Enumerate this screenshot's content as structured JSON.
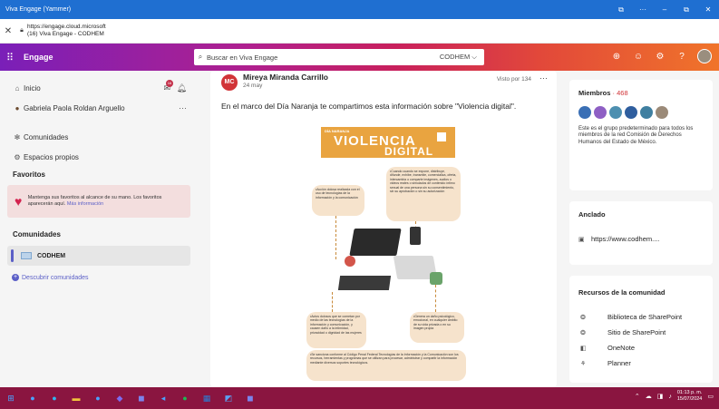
{
  "window": {
    "title": "Viva Engage (Yammer)",
    "controls": {
      "extension": "⧉",
      "more": "···",
      "minimize": "–",
      "restore": "⧉",
      "close": "✕"
    }
  },
  "address": {
    "url_line1": "https://engage.cloud.microsoft",
    "url_line2": "(16) Viva Engage - CODHEM"
  },
  "header": {
    "brand": "Engage",
    "search_placeholder": "Buscar en Viva Engage",
    "search_scope": "CODHEM ⌵"
  },
  "sidebar": {
    "inicio": "Inicio",
    "inicio_badge": "16",
    "user_name": "Gabriela Paola Roldan Arguello",
    "user_more": "···",
    "comunidades": "Comunidades",
    "espacios": "Espacios propios",
    "favoritos_title": "Favoritos",
    "favoritos_text": "Mantenga sus favoritos al alcance de su mano. Los favoritos aparecerán aquí.",
    "favoritos_link": "Más información",
    "comunidades_title": "Comunidades",
    "community_name": "CODHEM",
    "discover": "Descubrir comunidades"
  },
  "post": {
    "avatar_initials": "MC",
    "author": "Mireya Miranda Carrillo",
    "date": "24 may",
    "seen_by": "Visto por 134",
    "more": "···",
    "text": "En el marco del Día Naranja te compartimos esta información sobre \"Violencia digital\".",
    "infographic": {
      "kicker": "DÍA NARANJA",
      "title1": "VIOLENCIA",
      "title2": "DIGITAL",
      "b1": "•Acción dolosa realizada con el uso de tecnologías de la información y la comunicación",
      "b2": "•Cuando cuando se expone, distribuye, difunde, exhibe, transmite, comercializa, oferta, intercambia o comparte imágenes, audios o videos reales o simulados de contenido íntimo sexual de una persona sin su consentimiento, sin su aprobación o sin su autorización",
      "b3": "•Actos dolosos que se cometan por medio de las tecnologías de la información y comunicación, y causen daño a la intimidad, privacidad o dignidad de las mujeres",
      "b4": "•Genera un daño psicológico, emocional, en cualquier ámbito de su vida privada o en su imagen propia",
      "b5": "•Se sanciona conforme al Código Penal Federal Tecnologías de la Información y la Comunicación son los recursos, herramientas y programas que se utilizan para procesar, administrar y compartir la información mediante diversos soportes tecnológicos."
    }
  },
  "right": {
    "miembros": "Miembros",
    "miembros_count": "· 468",
    "miembros_desc": "Este es el grupo predeterminado para todos los miembros de la red Comisión de Derechos Humanos del Estado de México.",
    "anclado": "Anclado",
    "pinned_link": "https://www.codhem....",
    "recursos": "Recursos de la comunidad",
    "res1": "Biblioteca de SharePoint",
    "res2": "Sitio de SharePoint",
    "res3": "OneNote",
    "res4": "Planner"
  },
  "taskbar": {
    "time": "01:13 p. m.",
    "date": "15/07/2024"
  },
  "colors": {
    "titlebar": "#1f6fd1",
    "accent": "#5b5fc7",
    "taskbar": "#8a1540",
    "infographic_orange": "#e9a440"
  }
}
